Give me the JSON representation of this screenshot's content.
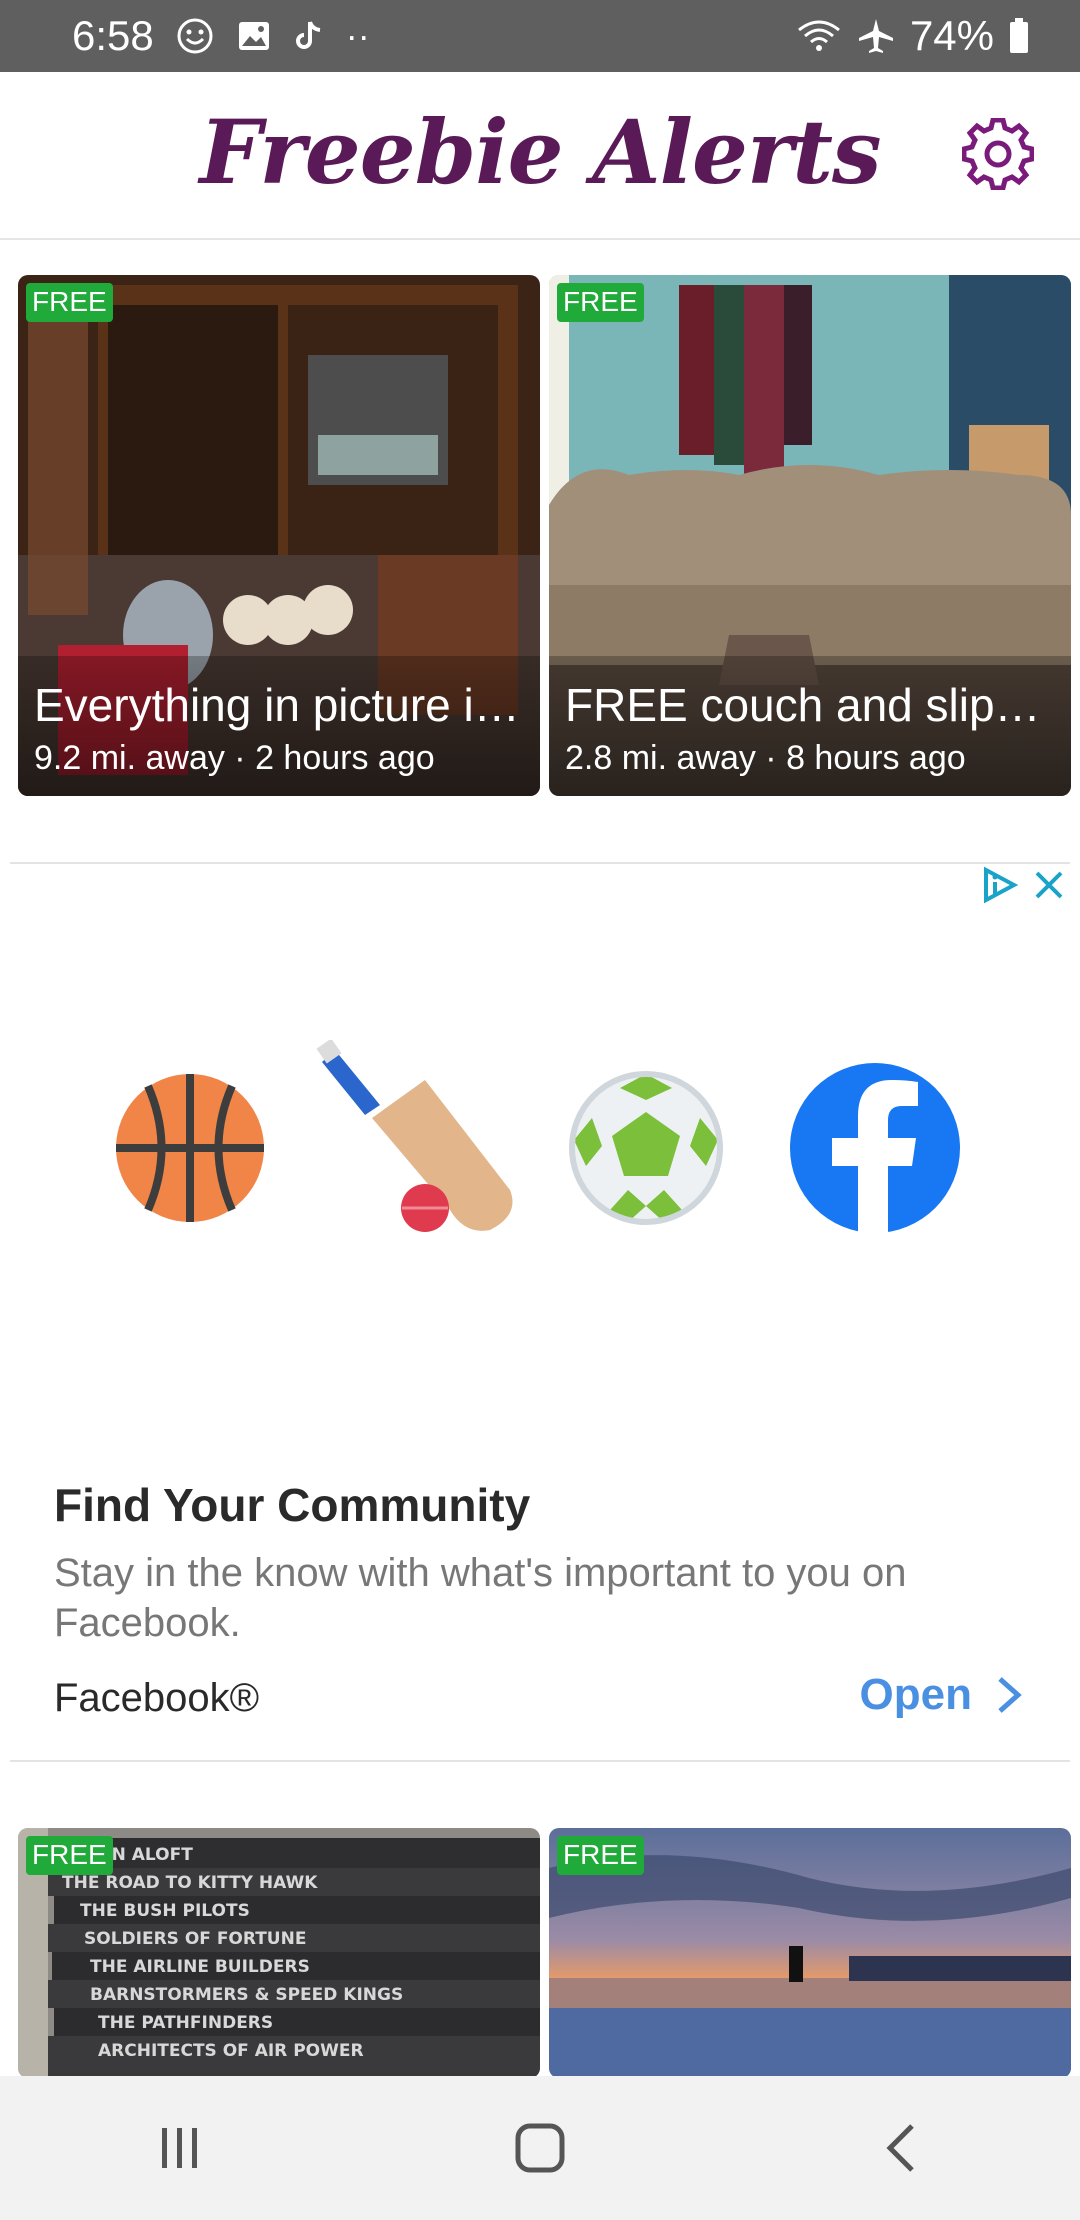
{
  "status_bar": {
    "time": "6:58",
    "battery": "74%",
    "left_icons": [
      "smiley-icon",
      "image-icon",
      "tiktok-icon",
      "more-dots-icon"
    ],
    "right_icons": [
      "wifi-icon",
      "airplane-icon",
      "battery-icon"
    ]
  },
  "header": {
    "title": "Freebie Alerts",
    "title_color": "#5a1a58",
    "settings_icon": "gear-icon"
  },
  "listings": [
    {
      "badge": "FREE",
      "title": "Everything in picture i…",
      "meta": "9.2 mi. away · 2 hours ago"
    },
    {
      "badge": "FREE",
      "title": "FREE couch and slipc…",
      "meta": "2.8 mi. away · 8 hours ago"
    },
    {
      "badge": "FREE",
      "spine_lines": [
        "EN ALOFT",
        "THE ROAD TO KITTY HAWK",
        "THE BUSH PILOTS",
        "SOLDIERS OF FORTUNE",
        "THE AIRLINE BUILDERS",
        "BARNSTORMERS & SPEED KINGS",
        "THE PATHFINDERS",
        "ARCHITECTS OF AIR POWER"
      ]
    },
    {
      "badge": "FREE"
    }
  ],
  "ad": {
    "title": "Find Your Community",
    "body": "Stay in the know with what's important to you on Facebook.",
    "brand": "Facebook®",
    "cta": "Open",
    "icons": [
      "basketball-icon",
      "cricket-bat-icon",
      "soccer-ball-icon",
      "facebook-icon"
    ],
    "accent_color": "#4a90e2"
  },
  "colors": {
    "free_badge": "#1faa3a",
    "status_bar": "#5f5f5f"
  },
  "nav": {
    "buttons": [
      "recent-apps",
      "home",
      "back"
    ]
  }
}
